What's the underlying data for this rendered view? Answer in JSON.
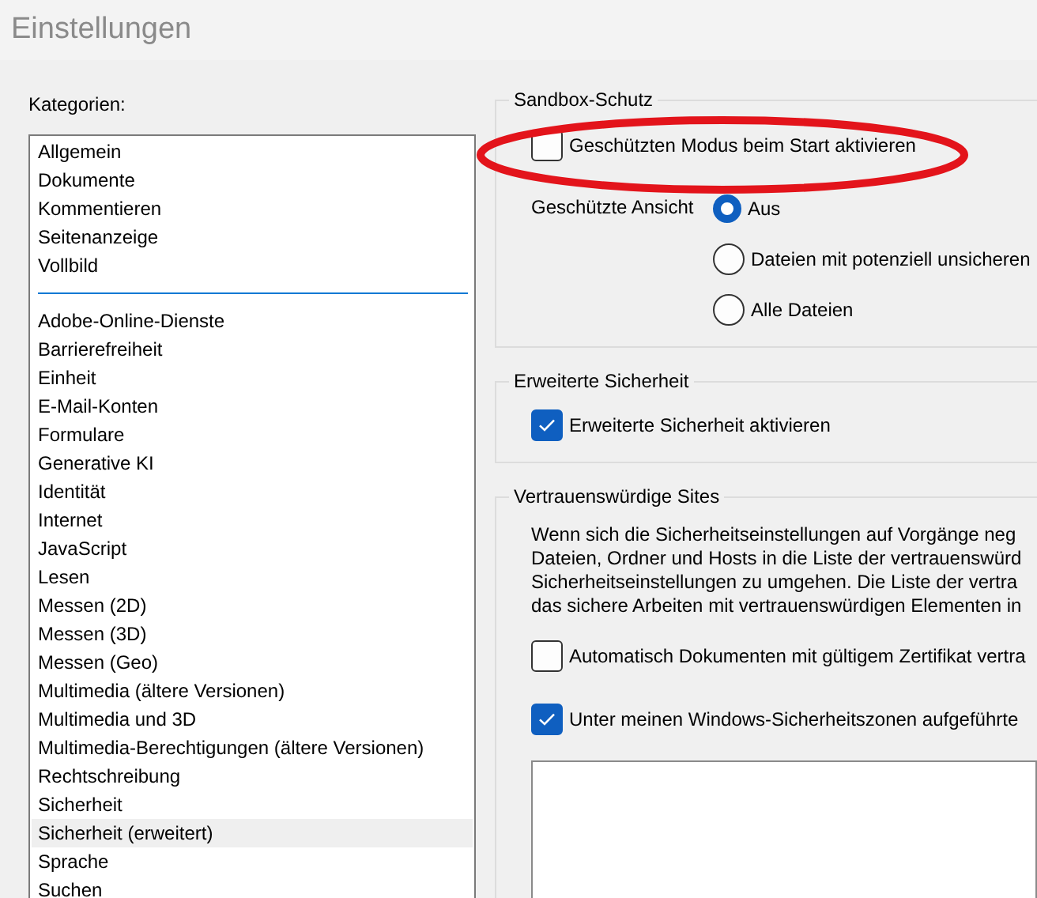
{
  "window": {
    "title": "Einstellungen"
  },
  "categories": {
    "label": "Kategorien:",
    "groups": [
      [
        {
          "label": "Allgemein",
          "selected": false
        },
        {
          "label": "Dokumente",
          "selected": false
        },
        {
          "label": "Kommentieren",
          "selected": false
        },
        {
          "label": "Seitenanzeige",
          "selected": false
        },
        {
          "label": "Vollbild",
          "selected": false
        }
      ],
      [
        {
          "label": "Adobe-Online-Dienste",
          "selected": false
        },
        {
          "label": "Barrierefreiheit",
          "selected": false
        },
        {
          "label": "Einheit",
          "selected": false
        },
        {
          "label": "E-Mail-Konten",
          "selected": false
        },
        {
          "label": "Formulare",
          "selected": false
        },
        {
          "label": "Generative KI",
          "selected": false
        },
        {
          "label": "Identität",
          "selected": false
        },
        {
          "label": "Internet",
          "selected": false
        },
        {
          "label": "JavaScript",
          "selected": false
        },
        {
          "label": "Lesen",
          "selected": false
        },
        {
          "label": "Messen (2D)",
          "selected": false
        },
        {
          "label": "Messen (3D)",
          "selected": false
        },
        {
          "label": "Messen (Geo)",
          "selected": false
        },
        {
          "label": "Multimedia (ältere Versionen)",
          "selected": false
        },
        {
          "label": "Multimedia und 3D",
          "selected": false
        },
        {
          "label": "Multimedia-Berechtigungen (ältere Versionen)",
          "selected": false
        },
        {
          "label": "Rechtschreibung",
          "selected": false
        },
        {
          "label": "Sicherheit",
          "selected": false
        },
        {
          "label": "Sicherheit (erweitert)",
          "selected": true
        },
        {
          "label": "Sprache",
          "selected": false
        },
        {
          "label": "Suchen",
          "selected": false
        }
      ]
    ]
  },
  "sandbox": {
    "title": "Sandbox-Schutz",
    "protected_mode": {
      "label": "Geschützten Modus beim Start aktivieren",
      "checked": false
    },
    "protected_view": {
      "label": "Geschützte Ansicht",
      "options": [
        {
          "label": "Aus",
          "selected": true
        },
        {
          "label": "Dateien mit potenziell unsicheren",
          "selected": false
        },
        {
          "label": "Alle Dateien",
          "selected": false
        }
      ]
    }
  },
  "enhanced_security": {
    "title": "Erweiterte Sicherheit",
    "checkbox": {
      "label": "Erweiterte Sicherheit aktivieren",
      "checked": true
    }
  },
  "trusted_sites": {
    "title": "Vertrauenswürdige Sites",
    "description_lines": [
      "Wenn sich die Sicherheitseinstellungen auf Vorgänge neg",
      "Dateien, Ordner und Hosts in die Liste der vertrauenswürd",
      "Sicherheitseinstellungen zu umgehen. Die Liste der vertra",
      "das sichere Arbeiten mit vertrauenswürdigen Elementen in"
    ],
    "checkboxes": [
      {
        "label": "Automatisch Dokumenten mit gültigem Zertifikat vertra",
        "checked": false
      },
      {
        "label": "Unter meinen Windows-Sicherheitszonen aufgeführte",
        "checked": true
      }
    ]
  }
}
